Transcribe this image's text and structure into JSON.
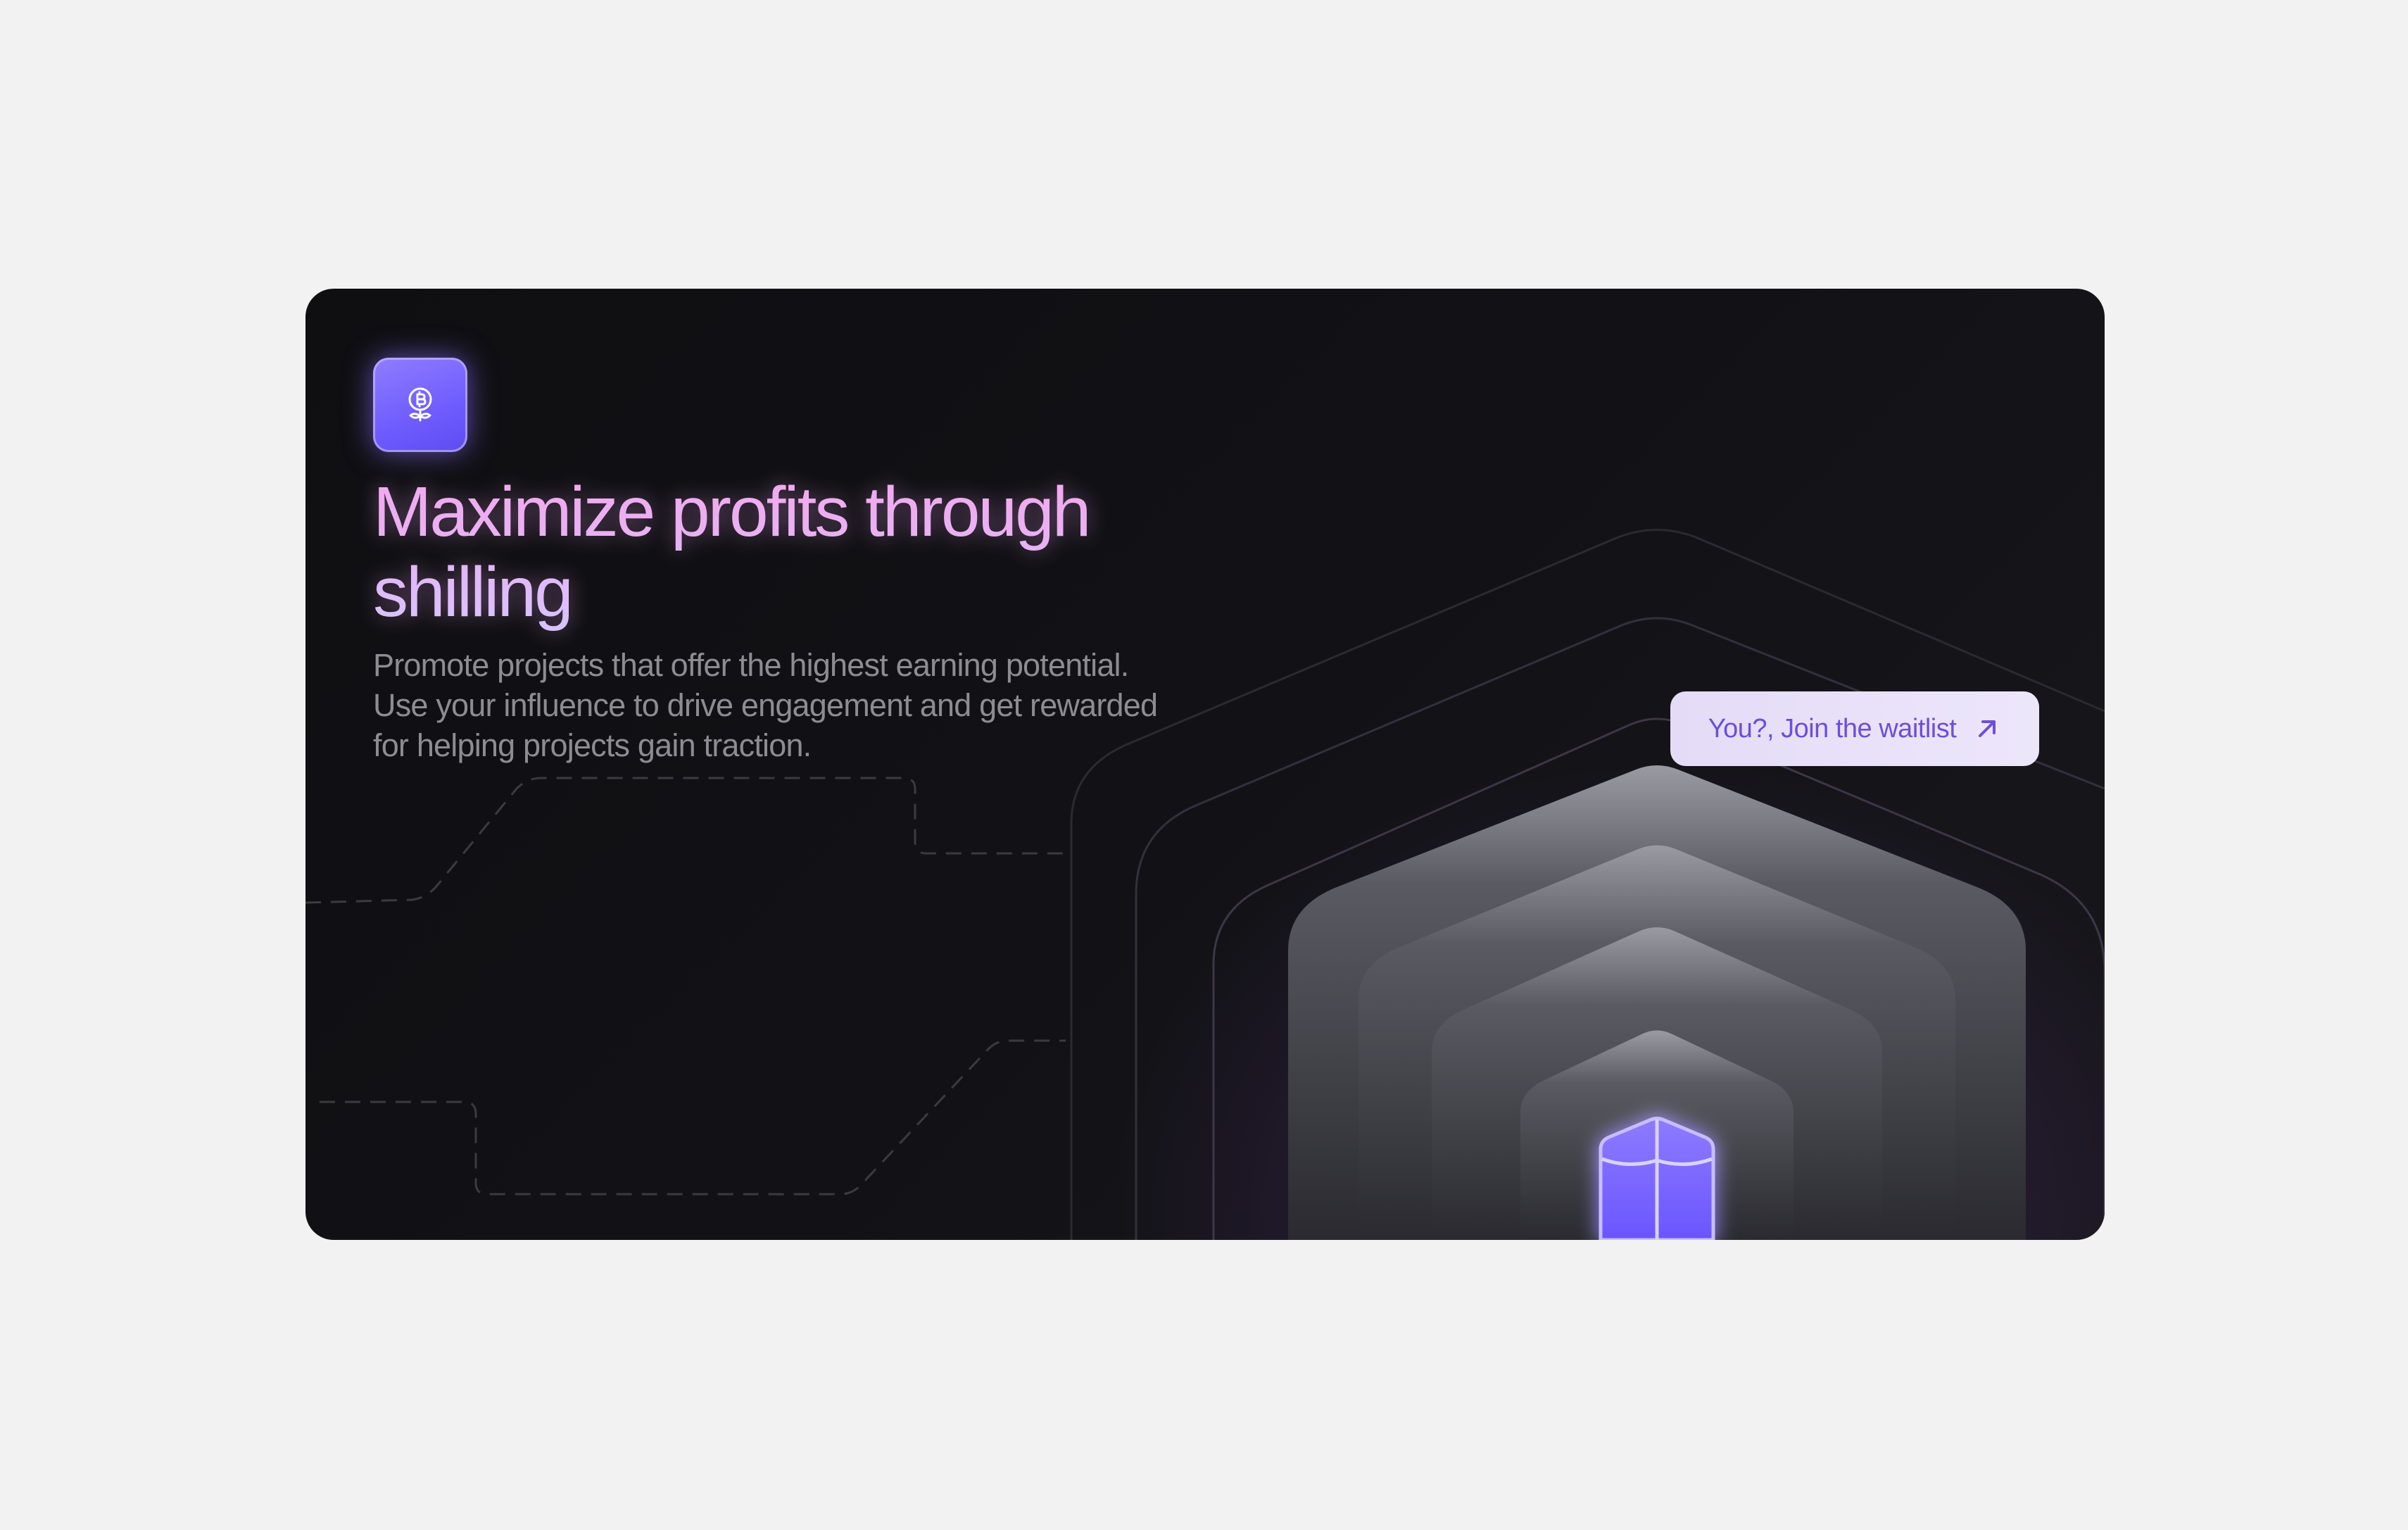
{
  "hero": {
    "icon": "bitcoin-plant-icon",
    "title_line1": "Maximize profits through",
    "title_line2": "shilling",
    "description_line1": "Promote projects that offer the highest earning potential.",
    "description_line2": "Use your influence to drive engagement and get rewarded",
    "description_line3": "for helping projects gain traction."
  },
  "cta": {
    "label": "You?, Join the waitlist",
    "icon": "arrow-up-right-icon"
  },
  "illustration": {
    "icon": "shield-icon"
  },
  "colors": {
    "page_background": "#f2f2f2",
    "card_background": "#111115",
    "accent_purple": "#6f5cff",
    "title_pink": "#f5a8ee",
    "title_lavender": "#d7c4ff",
    "body_text": "#8c8c92",
    "button_background": "#e8e0f9",
    "button_text": "#6a50d8"
  }
}
